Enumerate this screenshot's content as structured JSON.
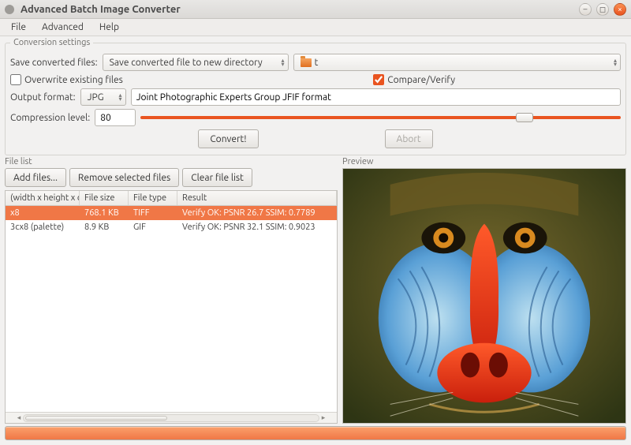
{
  "window": {
    "title": "Advanced Batch Image Converter"
  },
  "menu": {
    "file": "File",
    "advanced": "Advanced",
    "help": "Help"
  },
  "conversion": {
    "legend": "Conversion settings",
    "save_label": "Save converted files:",
    "save_mode": "Save converted file to new directory",
    "directory_display": "t",
    "overwrite_label": "Overwrite existing files",
    "overwrite_checked": false,
    "compare_label": "Compare/Verify",
    "compare_checked": true,
    "output_format_label": "Output format:",
    "output_format": "JPG",
    "output_format_desc": "Joint Photographic Experts Group JFIF format",
    "compression_label": "Compression level:",
    "compression_value": "80",
    "compression_min": 0,
    "compression_max": 100
  },
  "actions": {
    "convert": "Convert!",
    "abort": "Abort"
  },
  "filelist": {
    "label": "File list",
    "add": "Add files...",
    "remove": "Remove selected files",
    "clear": "Clear file list",
    "columns": {
      "dims": "(width x height x col",
      "size": "File size",
      "type": "File type",
      "result": "Result"
    },
    "rows": [
      {
        "dims": "x8",
        "size": "768.1 KB",
        "type": "TIFF",
        "result": "Verify OK: PSNR 26.7 SSIM: 0.7789",
        "selected": true
      },
      {
        "dims": "3cx8 (palette)",
        "size": "8.9 KB",
        "type": "GIF",
        "result": "Verify OK: PSNR 32.1 SSIM: 0.9023",
        "selected": false
      }
    ]
  },
  "preview": {
    "label": "Preview"
  },
  "colors": {
    "accent": "#e95420"
  }
}
